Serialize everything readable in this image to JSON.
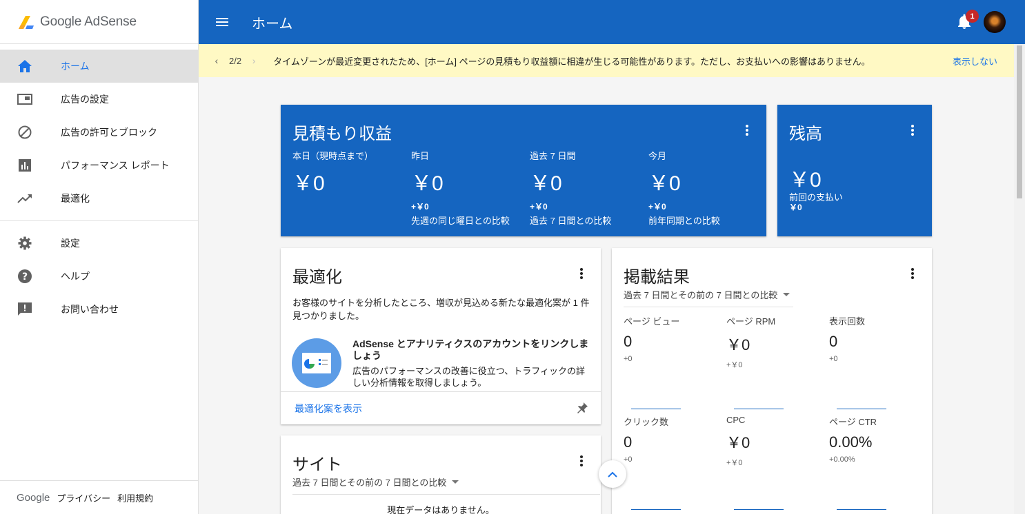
{
  "brand": {
    "name": "Google AdSense"
  },
  "sidebar": {
    "items": [
      {
        "label": "ホーム",
        "icon": "home-icon"
      },
      {
        "label": "広告の設定",
        "icon": "ad-unit-icon"
      },
      {
        "label": "広告の許可とブロック",
        "icon": "block-icon"
      },
      {
        "label": "パフォーマンス レポート",
        "icon": "bar-chart-icon"
      },
      {
        "label": "最適化",
        "icon": "trending-up-icon"
      }
    ],
    "secondary": [
      {
        "label": "設定",
        "icon": "gear-icon"
      },
      {
        "label": "ヘルプ",
        "icon": "help-icon"
      },
      {
        "label": "お問い合わせ",
        "icon": "feedback-icon"
      }
    ],
    "footer": {
      "google": "Google",
      "privacy": "プライバシー",
      "terms": "利用規約"
    }
  },
  "header": {
    "title": "ホーム",
    "notification_count": "1"
  },
  "notice": {
    "pager": "2/2",
    "message": "タイムゾーンが最近変更されたため、[ホーム] ページの見積もり収益額に相違が生じる可能性があります。ただし、お支払いへの影響はありません。",
    "dismiss": "表示しない"
  },
  "earnings": {
    "title": "見積もり収益",
    "metrics": [
      {
        "label": "本日（現時点まで）",
        "value": "￥0",
        "delta": "",
        "compare": ""
      },
      {
        "label": "昨日",
        "value": "￥0",
        "delta": "+￥0",
        "compare": "先週の同じ曜日との比較"
      },
      {
        "label": "過去 7 日間",
        "value": "￥0",
        "delta": "+￥0",
        "compare": "過去 7 日間との比較"
      },
      {
        "label": "今月",
        "value": "￥0",
        "delta": "+￥0",
        "compare": "前年同期との比較"
      }
    ]
  },
  "balance": {
    "title": "残高",
    "value": "￥0",
    "last_payment_label": "前回の支払い",
    "last_payment": "￥0"
  },
  "optimization": {
    "title": "最適化",
    "description": "お客様のサイトを分析したところ、増収が見込める新たな最適化案が 1 件見つかりました。",
    "headline": "AdSense とアナリティクスのアカウントをリンクしましょう",
    "subtext": "広告のパフォーマンスの改善に役立つ、トラフィックの詳しい分析情報を取得しましょう。",
    "link": "最適化案を表示"
  },
  "performance": {
    "title": "掲載結果",
    "range": "過去 7 日間とその前の 7 日間との比較",
    "metrics": [
      {
        "label": "ページ ビュー",
        "value": "0",
        "delta": "+0"
      },
      {
        "label": "ページ RPM",
        "value": "￥0",
        "delta": "+￥0"
      },
      {
        "label": "表示回数",
        "value": "0",
        "delta": "+0"
      },
      {
        "label": "クリック数",
        "value": "0",
        "delta": "+0"
      },
      {
        "label": "CPC",
        "value": "￥0",
        "delta": "+￥0"
      },
      {
        "label": "ページ CTR",
        "value": "0.00%",
        "delta": "+0.00%"
      }
    ]
  },
  "sites": {
    "title": "サイト",
    "range": "過去 7 日間とその前の 7 日間との比較",
    "empty": "現在データはありません。"
  },
  "colors": {
    "primary": "#1565c0",
    "accent": "#1a73e8",
    "notice_bg": "#fff9c4",
    "badge": "#c62828"
  }
}
